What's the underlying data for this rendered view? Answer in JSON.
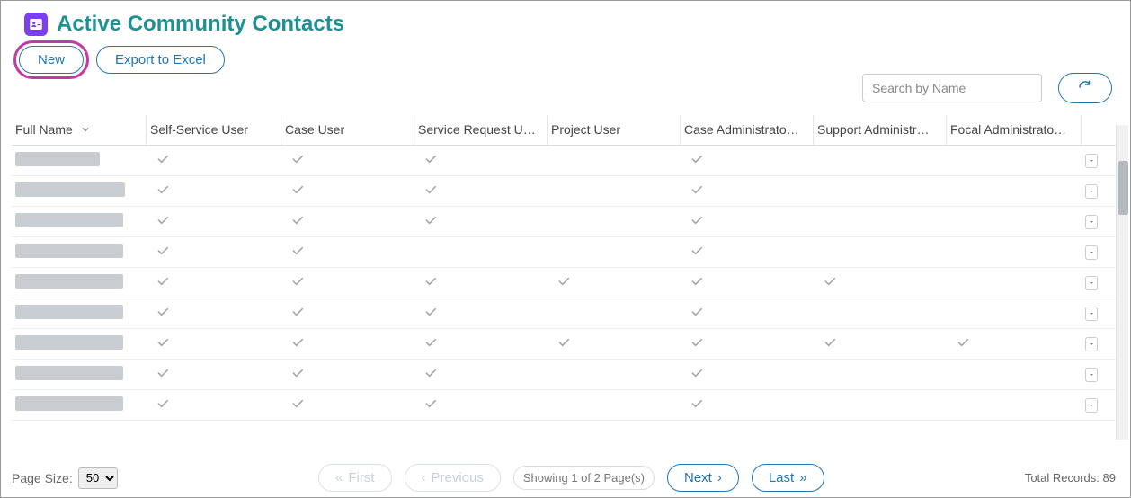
{
  "header": {
    "title": "Active Community Contacts",
    "icon": "contacts-icon"
  },
  "actions": {
    "new_label": "New",
    "export_label": "Export to Excel",
    "search_placeholder": "Search by Name",
    "refresh_icon": "refresh-icon"
  },
  "grid": {
    "columns": [
      "Full Name",
      "Self-Service User",
      "Case User",
      "Service Request U…",
      "Project User",
      "Case Administrato…",
      "Support Administr…",
      "Focal Administrato…"
    ],
    "rows": [
      {
        "nameWidth": 94,
        "checks": [
          true,
          true,
          true,
          false,
          true,
          false,
          false
        ]
      },
      {
        "nameWidth": 122,
        "checks": [
          true,
          true,
          true,
          false,
          true,
          false,
          false
        ]
      },
      {
        "nameWidth": 120,
        "checks": [
          true,
          true,
          true,
          false,
          true,
          false,
          false
        ]
      },
      {
        "nameWidth": 120,
        "checks": [
          true,
          true,
          false,
          false,
          true,
          false,
          false
        ]
      },
      {
        "nameWidth": 120,
        "checks": [
          true,
          true,
          true,
          true,
          true,
          true,
          false
        ]
      },
      {
        "nameWidth": 120,
        "checks": [
          true,
          true,
          true,
          false,
          true,
          false,
          false
        ]
      },
      {
        "nameWidth": 120,
        "checks": [
          true,
          true,
          true,
          true,
          true,
          true,
          true
        ]
      },
      {
        "nameWidth": 120,
        "checks": [
          true,
          true,
          true,
          false,
          true,
          false,
          false
        ]
      },
      {
        "nameWidth": 120,
        "checks": [
          true,
          true,
          true,
          false,
          true,
          false,
          false
        ]
      }
    ]
  },
  "pager": {
    "page_size_label": "Page Size:",
    "page_size_value": "50",
    "first": "First",
    "previous": "Previous",
    "next": "Next",
    "last": "Last",
    "status": "Showing 1  of  2   Page(s)",
    "total_label": "Total Records:",
    "total_value": "89"
  }
}
